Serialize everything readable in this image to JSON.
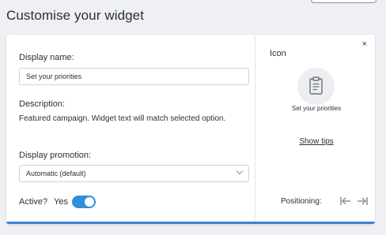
{
  "page": {
    "title": "Customise your widget"
  },
  "form": {
    "display_name_label": "Display name:",
    "display_name_value": "Set your priorities",
    "description_label": "Description:",
    "description_text": "Featured campaign. Widget text will match selected option.",
    "display_promotion_label": "Display promotion:",
    "display_promotion_selected": "Automatic (default)",
    "active_label": "Active?",
    "active_value_label": "Yes",
    "active": true
  },
  "preview": {
    "close_symbol": "×",
    "icon_label": "Icon",
    "icon_name": "clipboard-icon",
    "icon_caption": "Set your priorities",
    "show_tips_label": "Show tips",
    "positioning_label": "Positioning:",
    "position_icons": [
      "align-left-arrow-icon",
      "align-right-arrow-icon"
    ]
  },
  "colors": {
    "accent": "#2f8fd8",
    "card_border": "#3b82d6",
    "background": "#eef0f3",
    "muted_icon": "#9aa0a8"
  }
}
